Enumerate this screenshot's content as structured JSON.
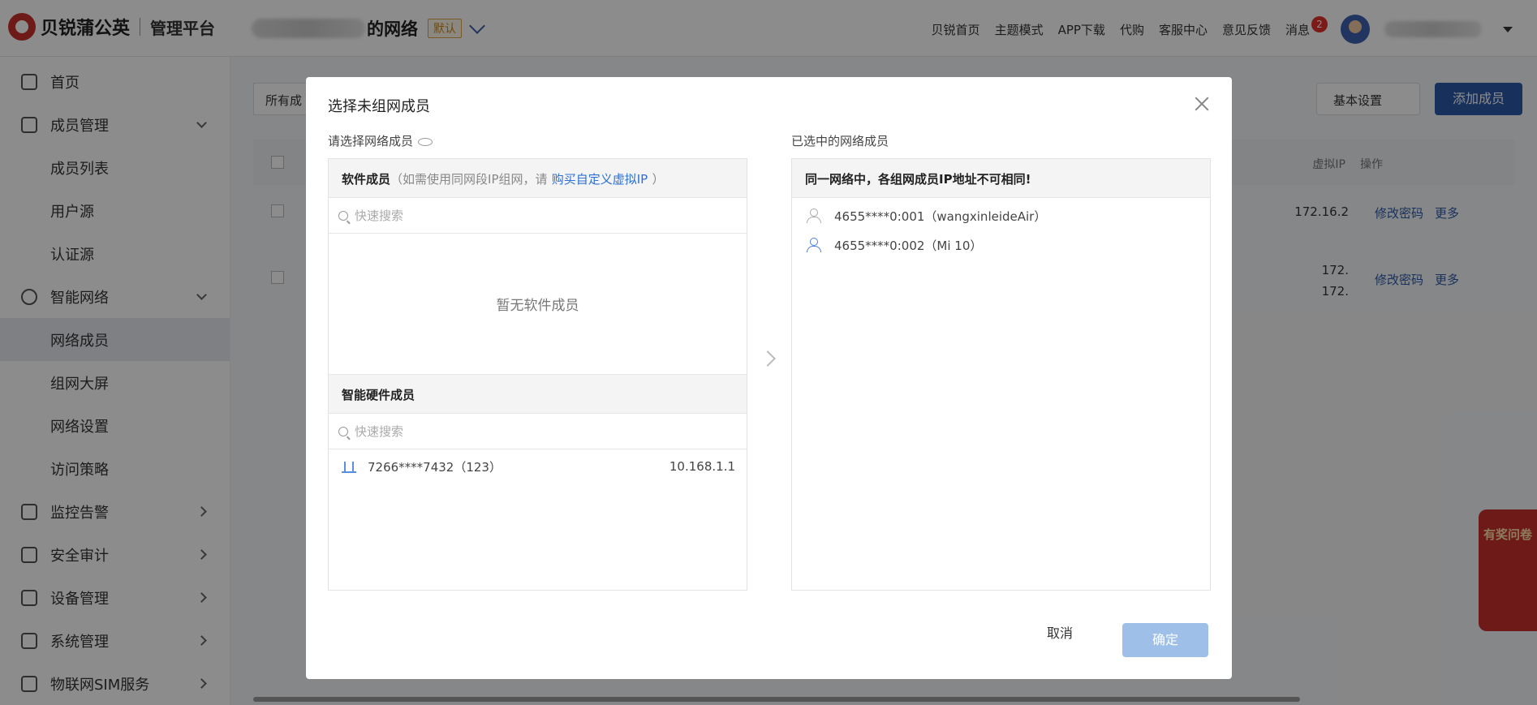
{
  "brand": {
    "name": "贝锐蒲公英",
    "platform": "管理平台"
  },
  "header": {
    "network_suffix": "的网络",
    "default_badge": "默认",
    "links": [
      "贝锐首页",
      "主题模式",
      "APP下载",
      "代购",
      "客服中心",
      "意见反馈"
    ],
    "messages_label": "消息",
    "messages_count": "2"
  },
  "sidebar": {
    "items": [
      {
        "label": "首页"
      },
      {
        "label": "成员管理"
      },
      {
        "label": "成员列表"
      },
      {
        "label": "用户源"
      },
      {
        "label": "认证源"
      },
      {
        "label": "智能网络"
      },
      {
        "label": "网络成员"
      },
      {
        "label": "组网大屏"
      },
      {
        "label": "网络设置"
      },
      {
        "label": "访问策略"
      },
      {
        "label": "监控告警"
      },
      {
        "label": "安全审计"
      },
      {
        "label": "设备管理"
      },
      {
        "label": "系统管理"
      },
      {
        "label": "物联网SIM服务"
      }
    ]
  },
  "main": {
    "filter_label": "所有成",
    "basic_settings": "基本设置",
    "add_member": "添加成员",
    "col_virtual_ip": "虚拟IP",
    "col_operation": "操作",
    "row1_ip": "172.16.2",
    "row2_ip_a": "172.",
    "row2_ip_b": "172.",
    "change_password": "修改密码",
    "more": "更多",
    "promo": "有奖问卷"
  },
  "modal": {
    "title": "选择未组网成员",
    "left_label": "请选择网络成员",
    "right_label": "已选中的网络成员",
    "software_title": "软件成员",
    "software_hint": "（如需使用同网段IP组网，请",
    "software_link": "购买自定义虚拟IP",
    "software_hint_end": "）",
    "search_placeholder": "快速搜索",
    "empty_software": "暂无软件成员",
    "hardware_title": "智能硬件成员",
    "hardware_items": [
      {
        "name": "7266****7432（123）",
        "ip": "10.168.1.1"
      }
    ],
    "right_notice": "同一网络中，各组网成员IP地址不可相同!",
    "selected_items": [
      {
        "name": "4655****0:001（wangxinleideAir）"
      },
      {
        "name": "4655****0:002（Mi 10）"
      }
    ],
    "cancel": "取消",
    "confirm": "确定"
  }
}
